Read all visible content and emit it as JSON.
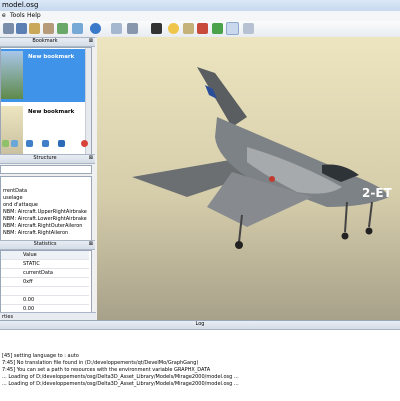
{
  "window": {
    "title": "model.osg"
  },
  "menu": {
    "items": [
      "e",
      "Tools",
      "Help"
    ]
  },
  "panels": {
    "bookmark": {
      "title": "Bookmark",
      "items": [
        {
          "label": "New bookmark"
        },
        {
          "label": "New bookmark"
        }
      ]
    },
    "structure": {
      "title": "Structure",
      "items": [
        "rrentData",
        "uselage",
        "ond d'attaque",
        "NBM: Aircraft.UpperRightAirbrake",
        "NBM: Aircraft.LowerRightAirbrake",
        "NBM: Aircraft.RightOuterAileron",
        "NBM: Aircraft.RightAileron"
      ]
    },
    "statistics": {
      "title": "Statistics",
      "header": {
        "col2": "Value"
      },
      "rows": [
        {
          "c1": "",
          "c2": "STATIC"
        },
        {
          "c1": "",
          "c2": "currentData"
        },
        {
          "c1": "",
          "c2": "0xff"
        },
        {
          "c1": "",
          "c2": ""
        },
        {
          "c1": "",
          "c2": "0.00"
        },
        {
          "c1": "",
          "c2": "0.00"
        }
      ]
    },
    "bottom_tab": {
      "label": "rties"
    }
  },
  "log": {
    "title": "Log",
    "lines": [
      "[45] setting language to : auto",
      "7:45] No translation file found in (D:/developpements/qt/DevelMo/GraphGang)",
      "7:45] You can set a path to resources with the environment variable GRAPHX_DATA",
      "... Loading of D:/developpements/osg/Delta3D_Asset_Library/Models/Mirage2000/model.osg ...",
      "... Loading of D:/developpements/osg/Delta3D_Asset_Library/Models/Mirage2000/model.osg ..."
    ]
  },
  "aircraft": {
    "tail_code": "2-ET"
  },
  "colors": {
    "bookmark_selected": "#3f93e8",
    "viewport_sky": "#ede5bf"
  }
}
